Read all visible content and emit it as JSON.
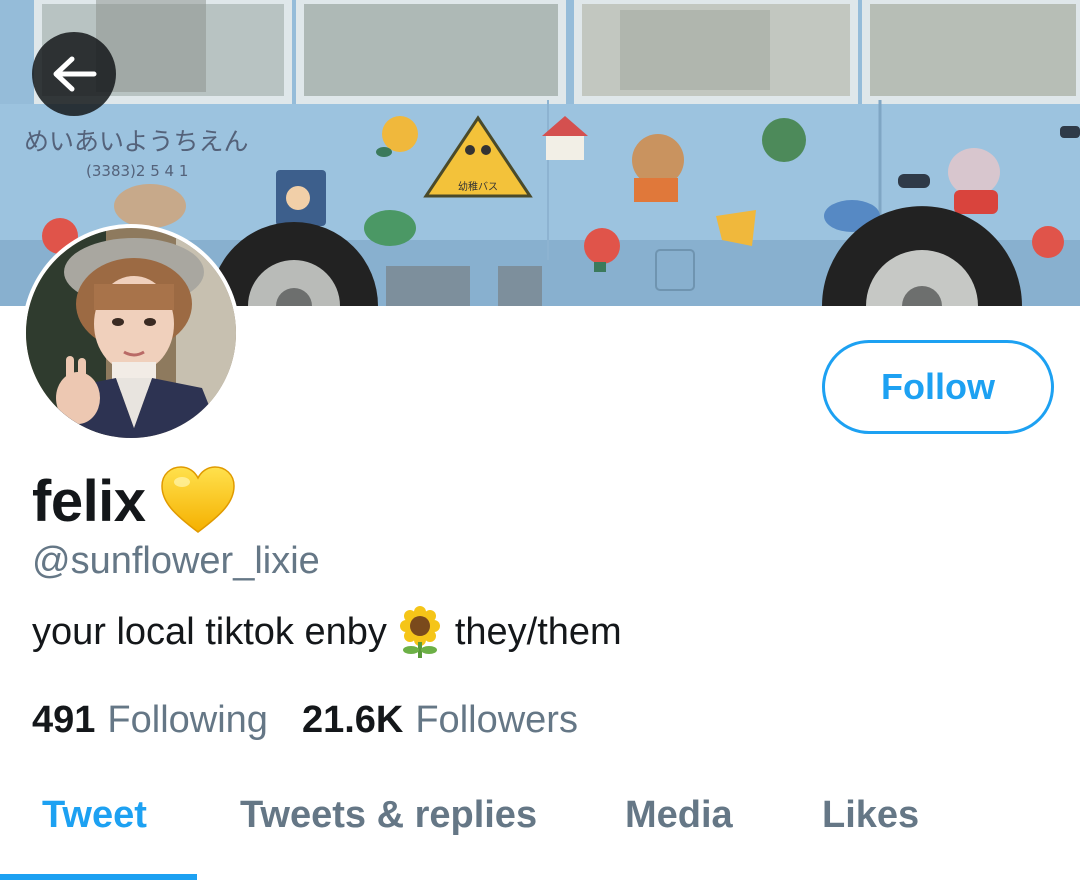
{
  "banner": {
    "bus_text_line1": "めいあいようちえん",
    "bus_text_line2": "(3383)2 5 4 1",
    "sign_text": "幼稚バス"
  },
  "header": {
    "back_icon": "arrow-left-icon"
  },
  "profile": {
    "display_name": "felix",
    "name_emoji": "yellow-heart-icon",
    "handle": "@sunflower_lixie",
    "bio_before": "your local tiktok enby",
    "bio_emoji": "sunflower-icon",
    "bio_after": "they/them",
    "following_count": "491",
    "following_label": "Following",
    "followers_count": "21.6K",
    "followers_label": "Followers"
  },
  "actions": {
    "follow_label": "Follow"
  },
  "tabs": [
    {
      "label": "Tweet",
      "active": true
    },
    {
      "label": "Tweets & replies",
      "active": false
    },
    {
      "label": "Media",
      "active": false
    },
    {
      "label": "Likes",
      "active": false
    }
  ],
  "colors": {
    "accent": "#1da1f2",
    "secondary_text": "#657786",
    "primary_text": "#14171a"
  }
}
